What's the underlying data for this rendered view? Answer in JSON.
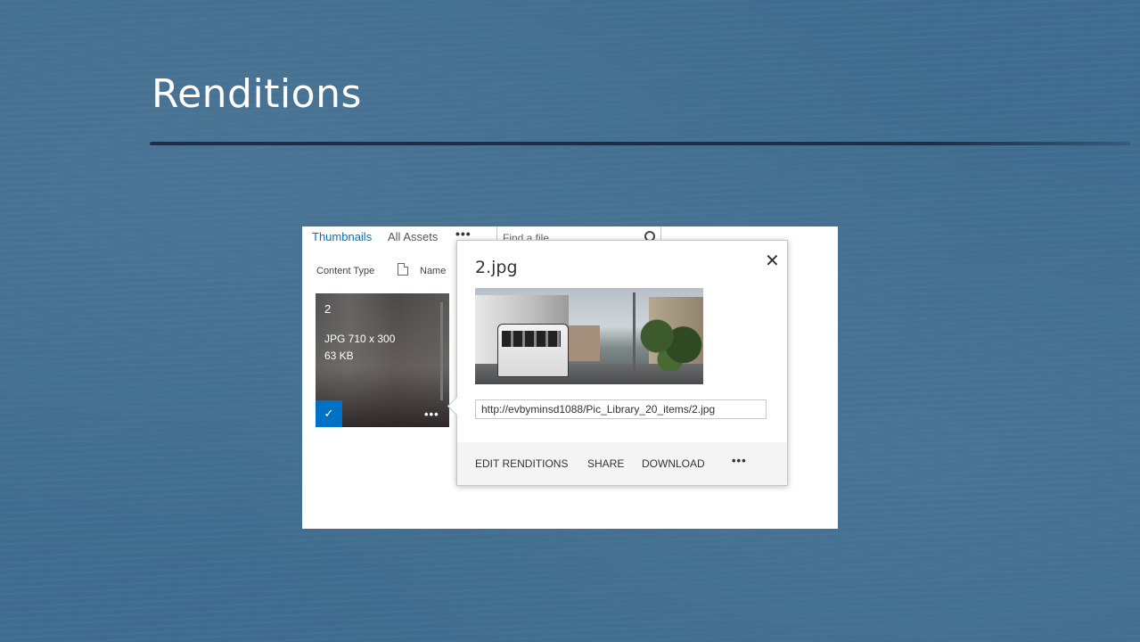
{
  "slide": {
    "title": "Renditions"
  },
  "library": {
    "tabs": [
      "Thumbnails",
      "All Assets"
    ],
    "more": "•••",
    "search_placeholder": "Find a file",
    "columns": [
      "Content Type",
      "Name"
    ],
    "tile": {
      "title": "2",
      "dims": "JPG 710 x 300",
      "size": "63 KB",
      "check": "✓",
      "more": "•••"
    }
  },
  "callout": {
    "title": "2.jpg",
    "close": "✕",
    "url": "http://evbyminsd1088/Pic_Library_20_items/2.jpg",
    "actions": [
      "EDIT RENDITIONS",
      "SHARE",
      "DOWNLOAD"
    ],
    "more": "•••"
  },
  "colors": {
    "background": "#3f6c8e",
    "accent": "#0072c6",
    "rule": "#1c2f48"
  }
}
